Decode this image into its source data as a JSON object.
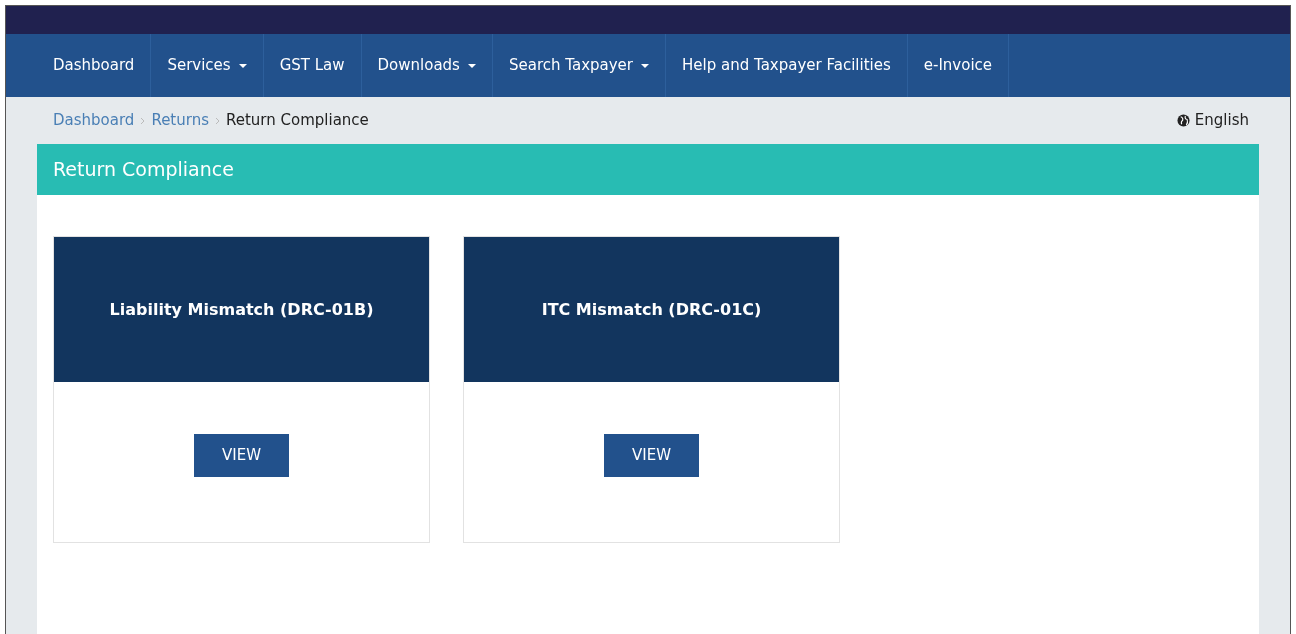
{
  "nav": [
    {
      "label": "Dashboard",
      "dropdown": false
    },
    {
      "label": "Services",
      "dropdown": true
    },
    {
      "label": "GST Law",
      "dropdown": false
    },
    {
      "label": "Downloads",
      "dropdown": true
    },
    {
      "label": "Search Taxpayer",
      "dropdown": true
    },
    {
      "label": "Help and Taxpayer Facilities",
      "dropdown": false
    },
    {
      "label": "e-Invoice",
      "dropdown": false
    }
  ],
  "breadcrumb": [
    {
      "label": "Dashboard",
      "link": true
    },
    {
      "label": "Returns",
      "link": true
    },
    {
      "label": "Return Compliance",
      "link": false
    }
  ],
  "language": "English",
  "panel": {
    "title": "Return Compliance",
    "cards": [
      {
        "title": "Liability Mismatch (DRC-01B)",
        "button": "VIEW"
      },
      {
        "title": "ITC Mismatch (DRC-01C)",
        "button": "VIEW"
      }
    ]
  }
}
